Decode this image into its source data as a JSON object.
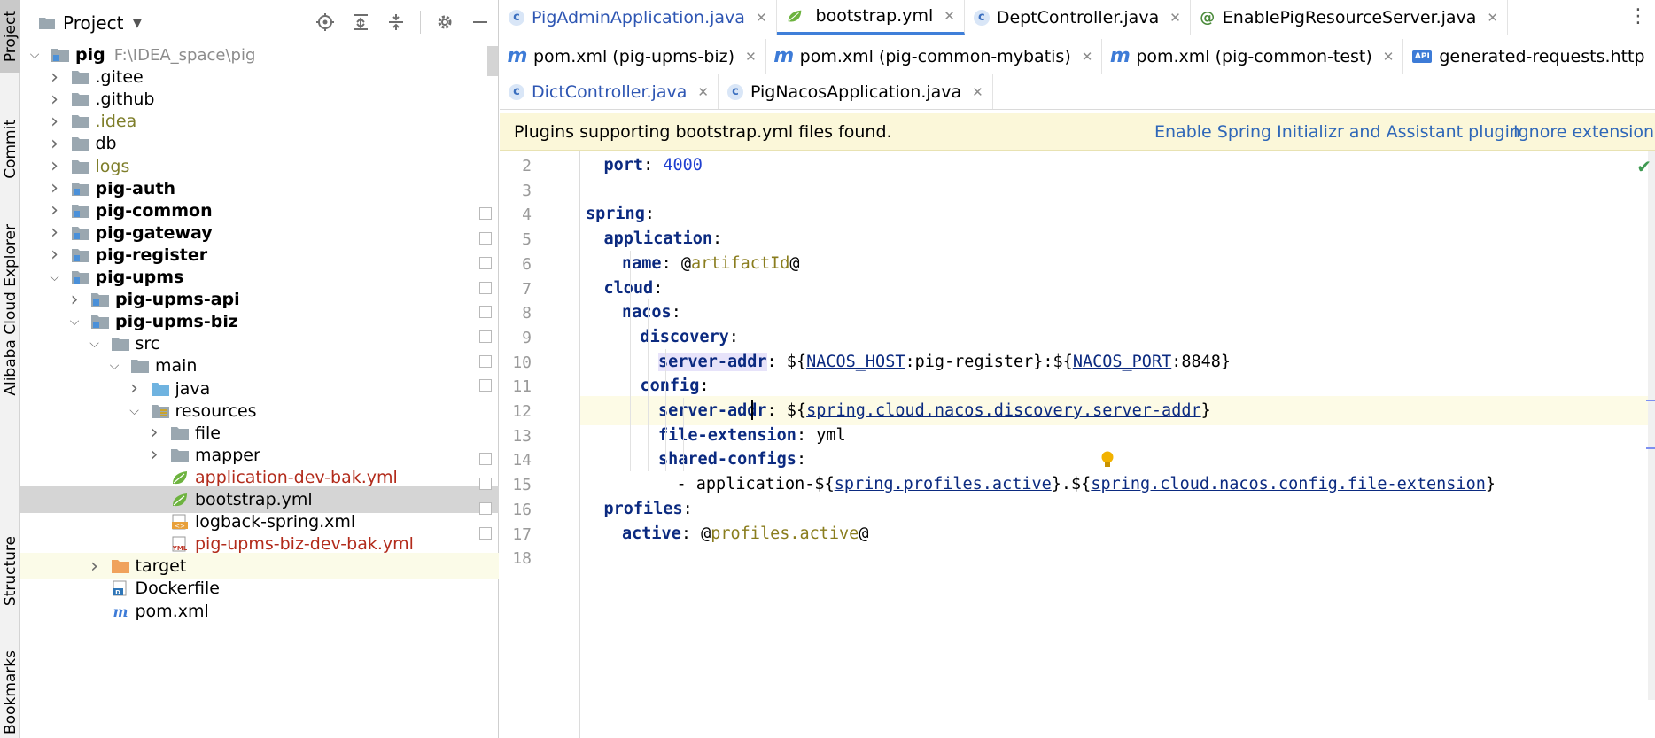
{
  "toolstrip": {
    "tabs": [
      "Project",
      "Commit",
      "Alibaba Cloud Explorer",
      "Structure",
      "Bookmarks"
    ]
  },
  "project": {
    "title": "Project",
    "tree": [
      {
        "label": "pig",
        "path": "F:\\IDEA_space\\pig",
        "depth": 0,
        "arrow": "open",
        "icon": "module",
        "style": "bold"
      },
      {
        "label": ".gitee",
        "depth": 1,
        "arrow": "closed",
        "icon": "folder",
        "style": "normal"
      },
      {
        "label": ".github",
        "depth": 1,
        "arrow": "closed",
        "icon": "folder",
        "style": "normal"
      },
      {
        "label": ".idea",
        "depth": 1,
        "arrow": "closed",
        "icon": "folder",
        "style": "olive"
      },
      {
        "label": "db",
        "depth": 1,
        "arrow": "closed",
        "icon": "folder",
        "style": "normal"
      },
      {
        "label": "logs",
        "depth": 1,
        "arrow": "closed",
        "icon": "folder",
        "style": "olive"
      },
      {
        "label": "pig-auth",
        "depth": 1,
        "arrow": "closed",
        "icon": "module",
        "style": "bold"
      },
      {
        "label": "pig-common",
        "depth": 1,
        "arrow": "closed",
        "icon": "module",
        "style": "bold"
      },
      {
        "label": "pig-gateway",
        "depth": 1,
        "arrow": "closed",
        "icon": "module",
        "style": "bold"
      },
      {
        "label": "pig-register",
        "depth": 1,
        "arrow": "closed",
        "icon": "module",
        "style": "bold"
      },
      {
        "label": "pig-upms",
        "depth": 1,
        "arrow": "open",
        "icon": "module",
        "style": "bold"
      },
      {
        "label": "pig-upms-api",
        "depth": 2,
        "arrow": "closed",
        "icon": "module",
        "style": "bold"
      },
      {
        "label": "pig-upms-biz",
        "depth": 2,
        "arrow": "open",
        "icon": "module",
        "style": "bold"
      },
      {
        "label": "src",
        "depth": 3,
        "arrow": "open",
        "icon": "folder",
        "style": "normal"
      },
      {
        "label": "main",
        "depth": 4,
        "arrow": "open",
        "icon": "folder",
        "style": "normal"
      },
      {
        "label": "java",
        "depth": 5,
        "arrow": "closed",
        "icon": "folder-blue",
        "style": "normal"
      },
      {
        "label": "resources",
        "depth": 5,
        "arrow": "open",
        "icon": "resources",
        "style": "normal"
      },
      {
        "label": "file",
        "depth": 6,
        "arrow": "closed",
        "icon": "folder",
        "style": "normal"
      },
      {
        "label": "mapper",
        "depth": 6,
        "arrow": "closed",
        "icon": "folder",
        "style": "normal"
      },
      {
        "label": "application-dev-bak.yml",
        "depth": 6,
        "arrow": "none",
        "icon": "spring-leaf",
        "style": "red"
      },
      {
        "label": "bootstrap.yml",
        "depth": 6,
        "arrow": "none",
        "icon": "spring-leaf",
        "style": "normal",
        "selected": true
      },
      {
        "label": "logback-spring.xml",
        "depth": 6,
        "arrow": "none",
        "icon": "xml",
        "style": "normal"
      },
      {
        "label": "pig-upms-biz-dev-bak.yml",
        "depth": 6,
        "arrow": "none",
        "icon": "yml",
        "style": "red"
      },
      {
        "label": "target",
        "depth": 3,
        "arrow": "closed",
        "icon": "folder-orange",
        "style": "normal",
        "highlight": true
      },
      {
        "label": "Dockerfile",
        "depth": 3,
        "arrow": "none",
        "icon": "docker",
        "style": "normal"
      },
      {
        "label": "pom.xml",
        "depth": 3,
        "arrow": "none",
        "icon": "maven",
        "style": "normal"
      }
    ]
  },
  "tabs": {
    "row1": [
      {
        "label": "PigAdminApplication.java",
        "icon": "c",
        "color": "blue"
      },
      {
        "label": "bootstrap.yml",
        "icon": "spring",
        "active": true
      },
      {
        "label": "DeptController.java",
        "icon": "c"
      },
      {
        "label": "EnablePigResourceServer.java",
        "icon": "at"
      }
    ],
    "row2": [
      {
        "label": "pom.xml (pig-upms-biz)",
        "icon": "m"
      },
      {
        "label": "pom.xml (pig-common-mybatis)",
        "icon": "m"
      },
      {
        "label": "pom.xml (pig-common-test)",
        "icon": "m"
      },
      {
        "label": "generated-requests.http",
        "icon": "api"
      }
    ],
    "row3": [
      {
        "label": "DictController.java",
        "icon": "c",
        "color": "blue"
      },
      {
        "label": "PigNacosApplication.java",
        "icon": "c"
      }
    ]
  },
  "banner": {
    "message": "Plugins supporting bootstrap.yml files found.",
    "link1": "Enable Spring Initializr and Assistant plugin",
    "link2": "Ignore extension"
  },
  "code": {
    "lines": [
      {
        "n": "2",
        "indent": 1,
        "tokens": [
          [
            "k",
            "port"
          ],
          [
            "p",
            ": "
          ],
          [
            "v",
            "4000"
          ]
        ]
      },
      {
        "n": "3",
        "indent": 0,
        "tokens": []
      },
      {
        "n": "4",
        "indent": 0,
        "tokens": [
          [
            "k",
            "spring"
          ],
          [
            "p",
            ":"
          ]
        ]
      },
      {
        "n": "5",
        "indent": 1,
        "tokens": [
          [
            "k",
            "application"
          ],
          [
            "p",
            ":"
          ]
        ]
      },
      {
        "n": "6",
        "indent": 2,
        "tokens": [
          [
            "k",
            "name"
          ],
          [
            "p",
            ": @"
          ],
          [
            "at",
            "artifactId"
          ],
          [
            "p",
            "@"
          ]
        ]
      },
      {
        "n": "7",
        "indent": 1,
        "tokens": [
          [
            "k",
            "cloud"
          ],
          [
            "p",
            ":"
          ]
        ]
      },
      {
        "n": "8",
        "indent": 2,
        "tokens": [
          [
            "k",
            "nacos"
          ],
          [
            "p",
            ":"
          ]
        ]
      },
      {
        "n": "9",
        "indent": 3,
        "tokens": [
          [
            "k",
            "discovery"
          ],
          [
            "p",
            ":"
          ]
        ]
      },
      {
        "n": "10",
        "indent": 4,
        "tokens": [
          [
            "kh",
            "server-addr"
          ],
          [
            "p",
            ": ${"
          ],
          [
            "u",
            "NACOS_HOST"
          ],
          [
            "p",
            ":pig-register}:${"
          ],
          [
            "u",
            "NACOS_PORT"
          ],
          [
            "p",
            ":8848}"
          ]
        ]
      },
      {
        "n": "11",
        "indent": 3,
        "tokens": [
          [
            "k",
            "config"
          ],
          [
            "p",
            ":"
          ]
        ]
      },
      {
        "n": "12",
        "indent": 4,
        "tokens": [
          [
            "k",
            "server-addr"
          ],
          [
            "p",
            ": ${"
          ],
          [
            "u",
            "spring.cloud.nacos.discovery.server-addr"
          ],
          [
            "p",
            "}"
          ]
        ],
        "current": true
      },
      {
        "n": "13",
        "indent": 4,
        "tokens": [
          [
            "k",
            "file-extension"
          ],
          [
            "p",
            ": yml"
          ]
        ]
      },
      {
        "n": "14",
        "indent": 4,
        "tokens": [
          [
            "k",
            "shared-configs"
          ],
          [
            "p",
            ":"
          ]
        ]
      },
      {
        "n": "15",
        "indent": 5,
        "tokens": [
          [
            "p",
            "- application-${"
          ],
          [
            "u",
            "spring.profiles.active"
          ],
          [
            "p",
            "}.${"
          ],
          [
            "u",
            "spring.cloud.nacos.config.file-extension"
          ],
          [
            "p",
            "}"
          ]
        ]
      },
      {
        "n": "16",
        "indent": 1,
        "tokens": [
          [
            "k",
            "profiles"
          ],
          [
            "p",
            ":"
          ]
        ]
      },
      {
        "n": "17",
        "indent": 2,
        "tokens": [
          [
            "k",
            "active"
          ],
          [
            "p",
            ": @"
          ],
          [
            "at",
            "profiles.active"
          ],
          [
            "p",
            "@"
          ]
        ]
      },
      {
        "n": "18",
        "indent": 0,
        "tokens": []
      }
    ]
  }
}
